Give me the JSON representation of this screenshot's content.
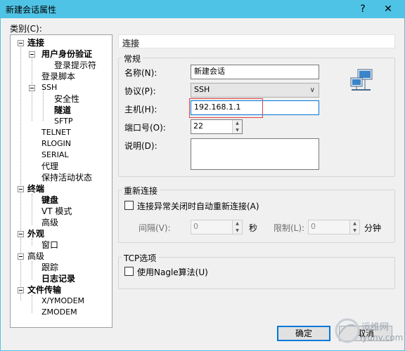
{
  "window": {
    "title": "新建会话属性",
    "help_label": "?",
    "close_label": "✕"
  },
  "category": {
    "label": "类别(C):",
    "items": [
      {
        "label": "连接"
      },
      {
        "label": "用户身份验证"
      },
      {
        "label": "登录提示符"
      },
      {
        "label": "登录脚本"
      },
      {
        "label": "SSH"
      },
      {
        "label": "安全性"
      },
      {
        "label": "隧道"
      },
      {
        "label": "SFTP"
      },
      {
        "label": "TELNET"
      },
      {
        "label": "RLOGIN"
      },
      {
        "label": "SERIAL"
      },
      {
        "label": "代理"
      },
      {
        "label": "保持活动状态"
      },
      {
        "label": "终端"
      },
      {
        "label": "键盘"
      },
      {
        "label": "VT 模式"
      },
      {
        "label": "高级"
      },
      {
        "label": "外观"
      },
      {
        "label": "窗口"
      },
      {
        "label": "高级"
      },
      {
        "label": "跟踪"
      },
      {
        "label": "日志记录"
      },
      {
        "label": "文件传输"
      },
      {
        "label": "X/YMODEM"
      },
      {
        "label": "ZMODEM"
      }
    ]
  },
  "panel": {
    "header": "连接",
    "general": {
      "title": "常规",
      "name_label": "名称(N):",
      "name_value": "新建会话",
      "protocol_label": "协议(P):",
      "protocol_value": "SSH",
      "host_label": "主机(H):",
      "host_value": "192.168.1.1",
      "port_label": "端口号(O):",
      "port_value": "22",
      "desc_label": "说明(D):",
      "desc_value": ""
    },
    "reconnect": {
      "title": "重新连接",
      "checkbox_label": "连接异常关闭时自动重新连接(A)",
      "interval_label": "间隔(V):",
      "interval_value": "0",
      "interval_unit": "秒",
      "limit_label": "限制(L):",
      "limit_value": "0",
      "limit_unit": "分钟"
    },
    "tcp": {
      "title": "TCP选项",
      "checkbox_label": "使用Nagle算法(U)"
    }
  },
  "buttons": {
    "ok": "确定",
    "cancel": "取消"
  },
  "watermark": {
    "line1": "运维网",
    "line2": "iyunv.com"
  }
}
